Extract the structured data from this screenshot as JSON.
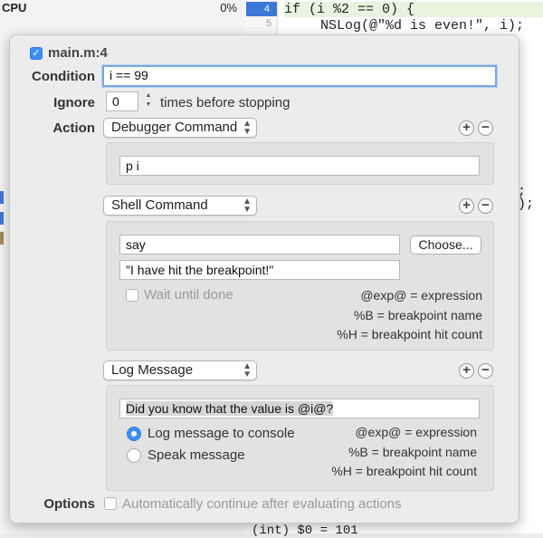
{
  "background": {
    "left_header": "CPU",
    "left_value": "0%",
    "breakpoint_line": "4",
    "line5": "5",
    "code_line1": "if (i %2 == 0) {",
    "code_line2": "NSLog(@\"%d is even!\", i);",
    "semicolon1": ";",
    "semicolon2": ");",
    "console_line": "(int) $0 = 101"
  },
  "breakpoint": {
    "enabled": true,
    "location": "main.m:4",
    "condition_label": "Condition",
    "condition_value": "i == 99",
    "ignore_label": "Ignore",
    "ignore_value": "0",
    "ignore_suffix": "times before stopping",
    "action_label": "Action",
    "options_label": "Options",
    "auto_continue_label": "Automatically continue after evaluating actions"
  },
  "actions": [
    {
      "type": "Debugger Command",
      "command": "p i"
    },
    {
      "type": "Shell Command",
      "command": "say",
      "choose_label": "Choose...",
      "arguments": "\"I have hit the breakpoint!\"",
      "wait_label": "Wait until done",
      "hint1": "@exp@ = expression",
      "hint2": "%B = breakpoint name",
      "hint3": "%H = breakpoint hit count"
    },
    {
      "type": "Log Message",
      "message": "Did you know that the value is @i@?",
      "option_console": "Log message to console",
      "option_speak": "Speak message",
      "hint1": "@exp@ = expression",
      "hint2": "%B = breakpoint name",
      "hint3": "%H = breakpoint hit count"
    }
  ],
  "icons": {
    "plus": "+",
    "minus": "−",
    "check": "✓",
    "popup_arrows": "▲▼"
  }
}
